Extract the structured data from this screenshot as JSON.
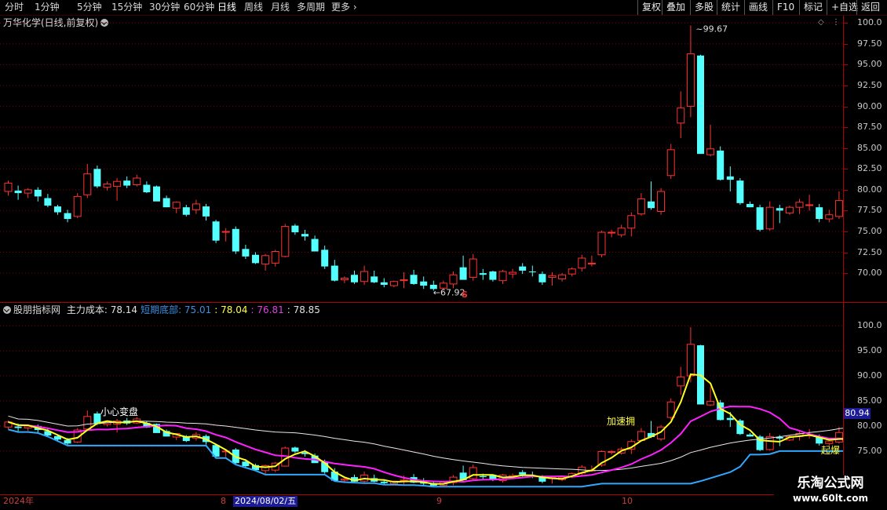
{
  "toolbar": {
    "left_items": [
      "分时",
      "1分钟",
      "5分钟",
      "15分钟",
      "30分钟",
      "60分钟",
      "日线",
      "周线",
      "月线",
      "多周期",
      "更多"
    ],
    "active": "日线",
    "right_items": [
      "复权",
      "叠加",
      "多股",
      "统计",
      "画线",
      "F10",
      "标记",
      "+自选",
      "返回"
    ]
  },
  "main_panel": {
    "title": "万华化学(日线,前复权)",
    "axis_ticks": [
      "100.0",
      "97.50",
      "95.00",
      "92.50",
      "90.00",
      "87.50",
      "85.00",
      "82.50",
      "80.00",
      "77.50",
      "75.00",
      "72.50",
      "70.00"
    ],
    "high_label": "99.67",
    "low_label": "67.92",
    "marker": "S"
  },
  "indicator_panel": {
    "title": "股朋指标网",
    "items": [
      {
        "label": "主力成本:",
        "value": "78.14",
        "color": "#e0e0e0"
      },
      {
        "label": "短期底部:",
        "value": "75.01",
        "color": "#3a8fe0"
      },
      {
        "label": ":",
        "value": "78.04",
        "color": "#ffff40"
      },
      {
        "label": ":",
        "value": "76.81",
        "color": "#e040e0"
      },
      {
        "label": ":",
        "value": "78.85",
        "color": "#e0e0e0"
      }
    ],
    "axis_ticks": [
      "100.0",
      "95.00",
      "90.00",
      "85.00",
      "80.00",
      "75.00"
    ],
    "current_value": "80.94",
    "annotations": [
      "小心变盘",
      "加速拥",
      "起爆"
    ]
  },
  "date_axis": [
    "2024年",
    "8",
    "2024/08/02/五",
    "9",
    "10"
  ],
  "watermark": {
    "name": "乐淘公式网",
    "url": "www.60lt.com"
  },
  "chart_data": {
    "type": "candlestick",
    "ohlc": [
      [
        79.8,
        81.1,
        79.3,
        80.8
      ],
      [
        79.9,
        80.5,
        78.8,
        79.6
      ],
      [
        79.6,
        80.2,
        79.0,
        80.0
      ],
      [
        80.0,
        80.3,
        78.6,
        79.2
      ],
      [
        79.0,
        79.5,
        77.9,
        78.1
      ],
      [
        78.0,
        78.2,
        77.0,
        77.3
      ],
      [
        77.2,
        77.6,
        76.1,
        76.5
      ],
      [
        76.8,
        79.6,
        76.6,
        79.2
      ],
      [
        79.4,
        83.1,
        79.0,
        81.9
      ],
      [
        82.5,
        82.9,
        80.2,
        80.4
      ],
      [
        80.3,
        81.0,
        79.9,
        80.7
      ],
      [
        80.4,
        81.4,
        78.7,
        81.0
      ],
      [
        81.1,
        81.6,
        80.2,
        80.5
      ],
      [
        80.6,
        81.8,
        80.4,
        81.4
      ],
      [
        80.6,
        81.0,
        79.6,
        79.7
      ],
      [
        80.4,
        80.5,
        78.8,
        78.6
      ],
      [
        79.0,
        79.3,
        77.9,
        77.9
      ],
      [
        77.8,
        78.6,
        77.2,
        78.5
      ],
      [
        77.9,
        78.2,
        76.8,
        77.0
      ],
      [
        77.6,
        78.8,
        77.1,
        78.3
      ],
      [
        78.0,
        78.3,
        76.3,
        76.8
      ],
      [
        76.2,
        76.4,
        73.6,
        73.9
      ],
      [
        74.9,
        75.4,
        73.8,
        75.0
      ],
      [
        75.3,
        75.6,
        72.3,
        72.6
      ],
      [
        72.9,
        73.4,
        71.7,
        72.0
      ],
      [
        72.2,
        72.5,
        71.1,
        71.2
      ],
      [
        71.1,
        72.3,
        70.3,
        72.1
      ],
      [
        71.2,
        72.8,
        70.8,
        72.6
      ],
      [
        72.0,
        75.9,
        71.9,
        75.6
      ],
      [
        75.7,
        75.9,
        74.6,
        74.9
      ],
      [
        74.7,
        75.2,
        73.9,
        74.4
      ],
      [
        74.1,
        74.5,
        72.7,
        72.6
      ],
      [
        72.8,
        73.3,
        70.5,
        70.8
      ],
      [
        70.9,
        71.6,
        69.0,
        69.1
      ],
      [
        69.2,
        69.6,
        68.8,
        69.4
      ],
      [
        69.8,
        70.3,
        68.7,
        68.9
      ],
      [
        69.0,
        70.9,
        68.6,
        70.2
      ],
      [
        69.6,
        70.3,
        68.8,
        68.9
      ],
      [
        68.9,
        69.4,
        68.3,
        68.6
      ],
      [
        68.5,
        69.1,
        68.3,
        69.0
      ],
      [
        69.1,
        70.1,
        68.2,
        69.2
      ],
      [
        69.8,
        70.4,
        68.6,
        68.7
      ],
      [
        69.0,
        69.6,
        68.1,
        68.5
      ],
      [
        68.6,
        69.1,
        67.9,
        68.1
      ],
      [
        68.2,
        69.1,
        67.9,
        68.8
      ],
      [
        68.7,
        70.2,
        68.2,
        69.8
      ],
      [
        70.7,
        72.1,
        69.3,
        69.2
      ],
      [
        69.5,
        72.3,
        69.1,
        71.7
      ],
      [
        70.0,
        70.5,
        69.2,
        69.8
      ],
      [
        70.2,
        70.3,
        69.0,
        69.2
      ],
      [
        69.1,
        70.4,
        68.7,
        70.2
      ],
      [
        69.9,
        70.5,
        69.4,
        70.1
      ],
      [
        70.8,
        71.2,
        69.9,
        70.3
      ],
      [
        70.2,
        70.9,
        69.6,
        70.1
      ],
      [
        69.9,
        70.2,
        68.6,
        68.9
      ],
      [
        69.5,
        70.1,
        68.5,
        69.7
      ],
      [
        69.3,
        70.0,
        69.0,
        69.8
      ],
      [
        69.9,
        70.7,
        69.6,
        70.5
      ],
      [
        70.6,
        72.2,
        70.2,
        71.8
      ],
      [
        71.1,
        72.1,
        70.8,
        71.2
      ],
      [
        72.2,
        75.1,
        71.9,
        74.9
      ],
      [
        74.9,
        75.2,
        74.3,
        74.9
      ],
      [
        74.6,
        75.8,
        74.3,
        75.4
      ],
      [
        75.4,
        77.3,
        74.4,
        76.9
      ],
      [
        77.1,
        79.6,
        76.9,
        78.9
      ],
      [
        78.6,
        81.0,
        77.6,
        77.8
      ],
      [
        77.4,
        80.2,
        77.0,
        79.8
      ],
      [
        81.7,
        85.5,
        81.3,
        84.8
      ],
      [
        88.0,
        91.8,
        86.2,
        89.8
      ],
      [
        90.0,
        99.7,
        88.7,
        96.3
      ],
      [
        96.1,
        96.2,
        84.3,
        84.3
      ],
      [
        84.2,
        87.8,
        84.0,
        84.9
      ],
      [
        84.7,
        85.2,
        81.1,
        81.2
      ],
      [
        81.6,
        82.8,
        79.8,
        81.2
      ],
      [
        81.1,
        81.4,
        78.2,
        78.4
      ],
      [
        78.3,
        78.6,
        77.9,
        77.9
      ],
      [
        77.9,
        78.2,
        75.0,
        75.2
      ],
      [
        75.3,
        78.6,
        75.1,
        77.9
      ],
      [
        77.8,
        78.2,
        76.0,
        77.5
      ],
      [
        77.2,
        78.1,
        77.0,
        77.9
      ],
      [
        77.9,
        78.9,
        77.1,
        78.5
      ],
      [
        78.2,
        79.4,
        77.5,
        78.2
      ],
      [
        77.9,
        78.3,
        76.1,
        76.5
      ],
      [
        76.5,
        77.6,
        76.1,
        77.0
      ],
      [
        76.8,
        79.8,
        76.5,
        78.7
      ],
      [
        78.4,
        79.3,
        76.2,
        76.6
      ],
      [
        76.5,
        76.9,
        74.9,
        75.6
      ],
      [
        75.3,
        75.8,
        74.5,
        74.9
      ],
      [
        74.9,
        76.1,
        74.0,
        75.7
      ],
      [
        75.9,
        76.8,
        75.0,
        76.4
      ],
      [
        76.4,
        78.5,
        76.0,
        78.2
      ],
      [
        78.2,
        78.6,
        77.0,
        77.3
      ],
      [
        76.4,
        79.2,
        76.4,
        78.9
      ]
    ],
    "series": [
      {
        "name": "主力成本",
        "last": 78.14
      },
      {
        "name": "短期底部",
        "last": 75.01
      },
      {
        "value": 78.04
      },
      {
        "value": 76.81
      },
      {
        "value": 78.85
      }
    ],
    "main_ylim": [
      67.0,
      100.5
    ],
    "indicator_ylim": [
      67.0,
      103.0
    ]
  }
}
